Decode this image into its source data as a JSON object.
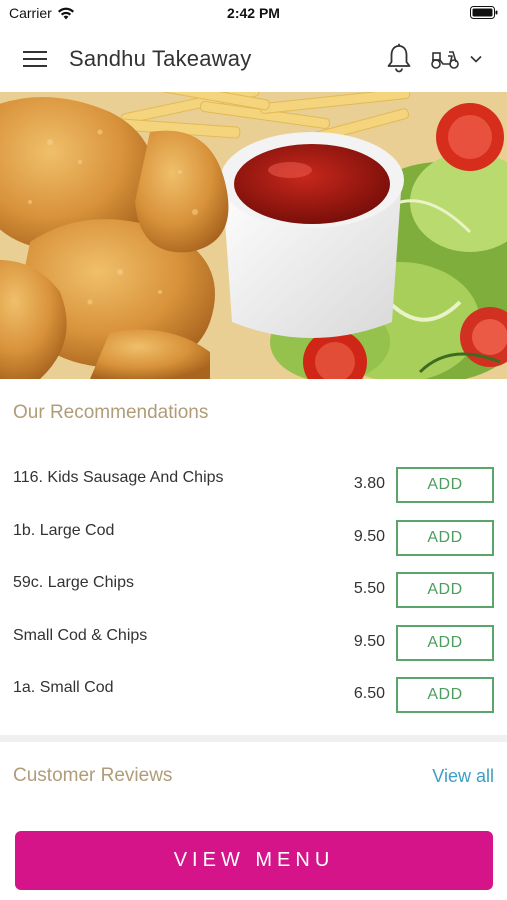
{
  "status_bar": {
    "carrier": "Carrier",
    "time": "2:42 PM"
  },
  "header": {
    "title": "Sandhu Takeaway",
    "icons": [
      "hamburger-menu-icon",
      "bell-icon",
      "scooter-delivery-icon",
      "chevron-down-icon"
    ]
  },
  "hero": {
    "image": "chicken-nuggets-ketchup-salad-photo"
  },
  "recommendations": {
    "title": "Our Recommendations",
    "add_label": "ADD",
    "items": [
      {
        "name": "116. Kids Sausage And Chips",
        "price": "3.80"
      },
      {
        "name": "1b. Large Cod",
        "price": "9.50"
      },
      {
        "name": "59c. Large Chips",
        "price": "5.50"
      },
      {
        "name": "Small Cod & Chips",
        "price": "9.50"
      },
      {
        "name": "1a. Small Cod",
        "price": "6.50"
      }
    ]
  },
  "reviews": {
    "title": "Customer Reviews",
    "view_all": "View all"
  },
  "footer": {
    "view_menu_label": "VIEW MENU"
  },
  "colors": {
    "accent": "#d6148a",
    "section_title": "#b09c78",
    "add_button": "#5aa66a",
    "link": "#3c9fc4"
  }
}
